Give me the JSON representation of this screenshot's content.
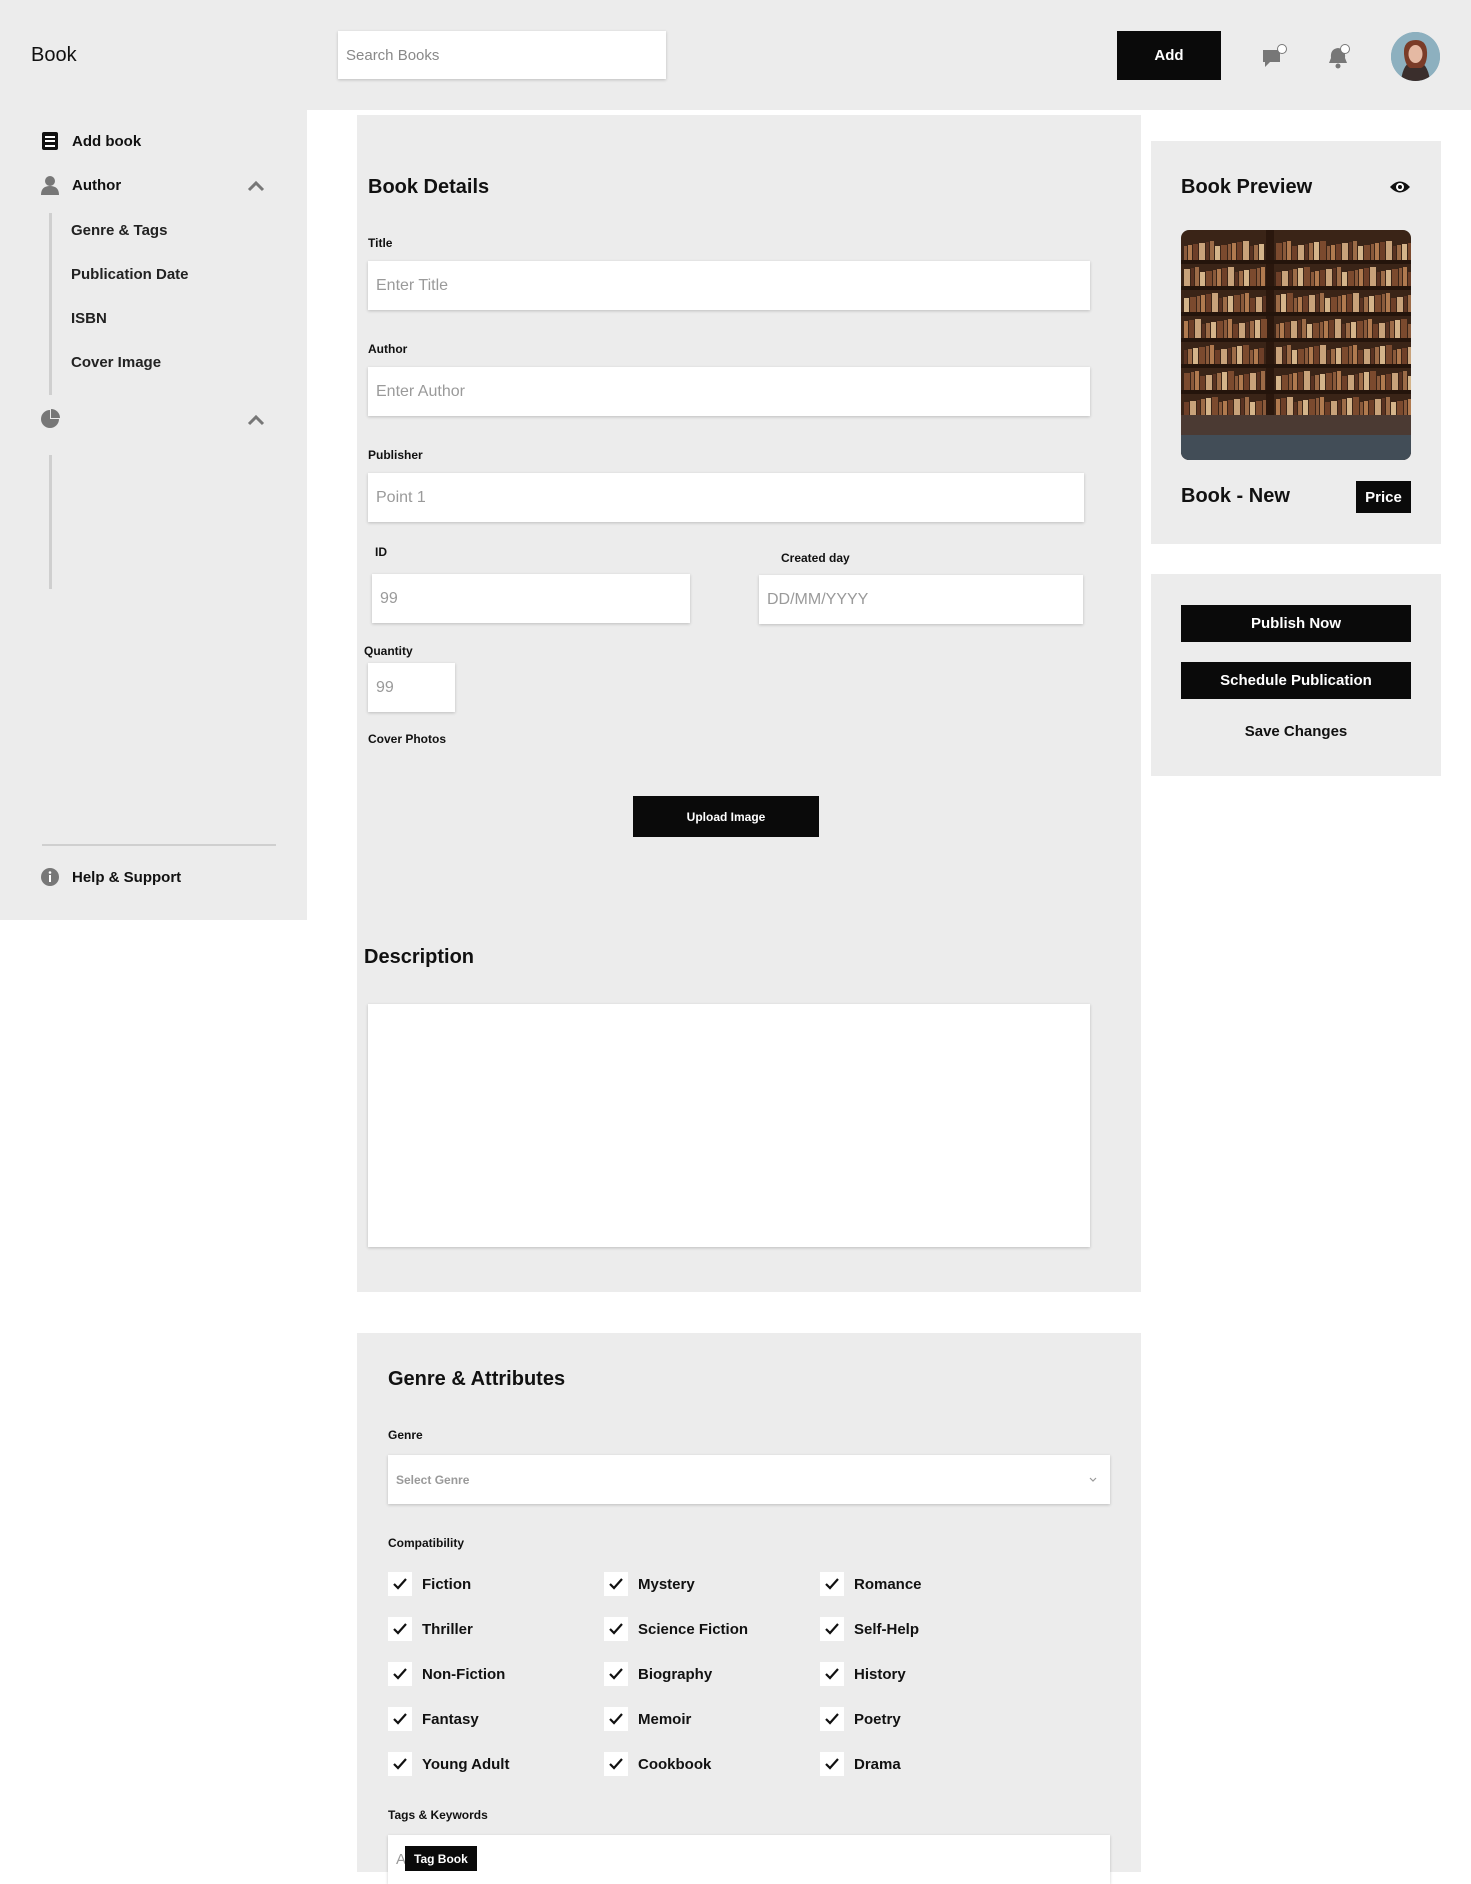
{
  "sidebar": {
    "brand": "Book",
    "items": [
      {
        "label": "Add book",
        "icon": "book-icon"
      },
      {
        "label": "Author",
        "icon": "person-icon"
      }
    ],
    "author_sub": [
      "Genre & Tags",
      "Publication Date",
      "ISBN",
      "Cover Image"
    ],
    "chart_group": {
      "label": "",
      "icon": "pie-chart-icon"
    },
    "help": "Help & Support"
  },
  "topbar": {
    "search_placeholder": "Search Books",
    "add_label": "Add"
  },
  "book_details": {
    "title": "Book Details",
    "title_label": "Title",
    "title_placeholder": "Enter Title",
    "author_label": "Author",
    "author_placeholder": "Enter Author",
    "publisher_label": "Publisher",
    "publisher_value": "Point 1",
    "id_label": "ID",
    "id_value": "99",
    "created_label": "Created day",
    "created_placeholder": "DD/MM/YYYY",
    "quantity_label": "Quantity",
    "quantity_value": "99",
    "cover_label": "Cover Photos",
    "upload_label": "Upload Image"
  },
  "description": {
    "title": "Description",
    "value": ""
  },
  "genre_section": {
    "title": "Genre & Attributes",
    "genre_label": "Genre",
    "genre_placeholder": "Select Genre",
    "compat_label": "Compatibility",
    "options": [
      "Fiction",
      "Mystery",
      "Romance",
      "Thriller",
      "Science Fiction",
      "Self-Help",
      "Non-Fiction",
      "Biography",
      "History",
      "Fantasy",
      "Memoir",
      "Poetry",
      "Young Adult",
      "Cookbook",
      "Drama"
    ],
    "tags_label": "Tags & Keywords",
    "tags_placeholder": "A",
    "tag_chip": "Tag Book"
  },
  "preview": {
    "title": "Book Preview",
    "book_name": "Book - New",
    "price_label": "Price"
  },
  "actions": {
    "publish": "Publish Now",
    "schedule": "Schedule Publication",
    "save": "Save Changes"
  }
}
